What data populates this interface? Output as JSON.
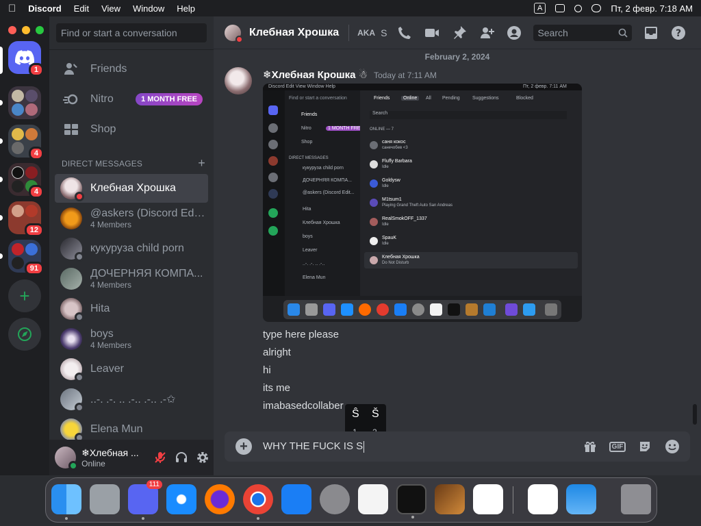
{
  "menubar": {
    "app_name": "Discord",
    "menus": [
      "Edit",
      "View",
      "Window",
      "Help"
    ],
    "input_source": "A",
    "datetime": "Пт, 2 февр.  7:18 AM"
  },
  "servers": {
    "badges": [
      "1",
      "4",
      "4",
      "12",
      "91"
    ]
  },
  "sidebar": {
    "search_placeholder": "Find or start a conversation",
    "nav": [
      {
        "label": "Friends"
      },
      {
        "label": "Nitro",
        "badge": "1 MONTH FREE"
      },
      {
        "label": "Shop"
      }
    ],
    "dm_header": "DIRECT MESSAGES",
    "dm_add": "+",
    "dms": [
      {
        "name": "Клебная Хрошка",
        "sub": ""
      },
      {
        "name": "@askers (Discord Edit...",
        "sub": "4 Members"
      },
      {
        "name": "кукуруза child porn",
        "sub": ""
      },
      {
        "name": "ДОЧЕРНЯЯ КОМПА...",
        "sub": "4 Members"
      },
      {
        "name": "Hita",
        "sub": ""
      },
      {
        "name": "boys",
        "sub": "4 Members"
      },
      {
        "name": "Leaver",
        "sub": ""
      },
      {
        "name": "..-. .-. .. .-.. .-.. .-✩",
        "sub": ""
      },
      {
        "name": "Elena Mun",
        "sub": ""
      }
    ]
  },
  "user_panel": {
    "name": "❄Хлебная ...",
    "status": "Online"
  },
  "header": {
    "title": "Клебная Хрошка",
    "aka": "AKA",
    "aka_letter": "S",
    "search_placeholder": "Search"
  },
  "chat": {
    "date_divider": "February 2, 2024",
    "author": "❄Хлебная Крошка ☃",
    "timestamp": "Today at 7:11 AM",
    "messages": [
      "type here please",
      "alright",
      "hi",
      "its me",
      "imabasedcollaber"
    ]
  },
  "screenshot_attachment": {
    "menubar_left": "Discord   Edit   View   Window   Help",
    "menubar_right": "Пт, 2 февр.  7:11 AM",
    "search": "Find or start a conversation",
    "nav": [
      "Friends",
      "Nitro",
      "Shop"
    ],
    "nitro_badge": "1 MONTH FREE",
    "dm_header": "DIRECT MESSAGES",
    "dms": [
      "кукуруза child porn",
      "ДОЧЕРНЯЯ КОМПА...",
      "@askers (Discord Edit...",
      "Hita",
      "Клебная Хрошка",
      "boys",
      "Leaver",
      "..-. .-. .. .-..",
      "Elena Mun"
    ],
    "tabs": [
      "Friends",
      "Online",
      "All",
      "Pending",
      "Suggestions",
      "Blocked"
    ],
    "friends_search": "Search",
    "online_header": "ONLINE — 7",
    "friends": [
      {
        "name": "саня кокос",
        "status": "санечобев <3"
      },
      {
        "name": "Fluffy Barbara",
        "status": "Idle"
      },
      {
        "name": "Goldysw",
        "status": "Idle"
      },
      {
        "name": "M1tsum1",
        "status": "Playing Grand Theft Auto San Andreas"
      },
      {
        "name": "RealSmokOFF_1337",
        "status": "Idle"
      },
      {
        "name": "SpauK",
        "status": "Idle"
      },
      {
        "name": "Клебная Хрошка",
        "status": "Do Not Disturb"
      }
    ]
  },
  "accent_picker": {
    "chars": [
      "Ŝ",
      "Š"
    ],
    "keys": [
      "1",
      "2"
    ]
  },
  "composer": {
    "value": "WHY THE FUCK IS S",
    "gif_label": "GIF"
  },
  "dock": {
    "discord_badge": "111"
  },
  "colors": {
    "blurple": "#5865f2",
    "danger": "#f23f43",
    "online": "#23a559"
  }
}
